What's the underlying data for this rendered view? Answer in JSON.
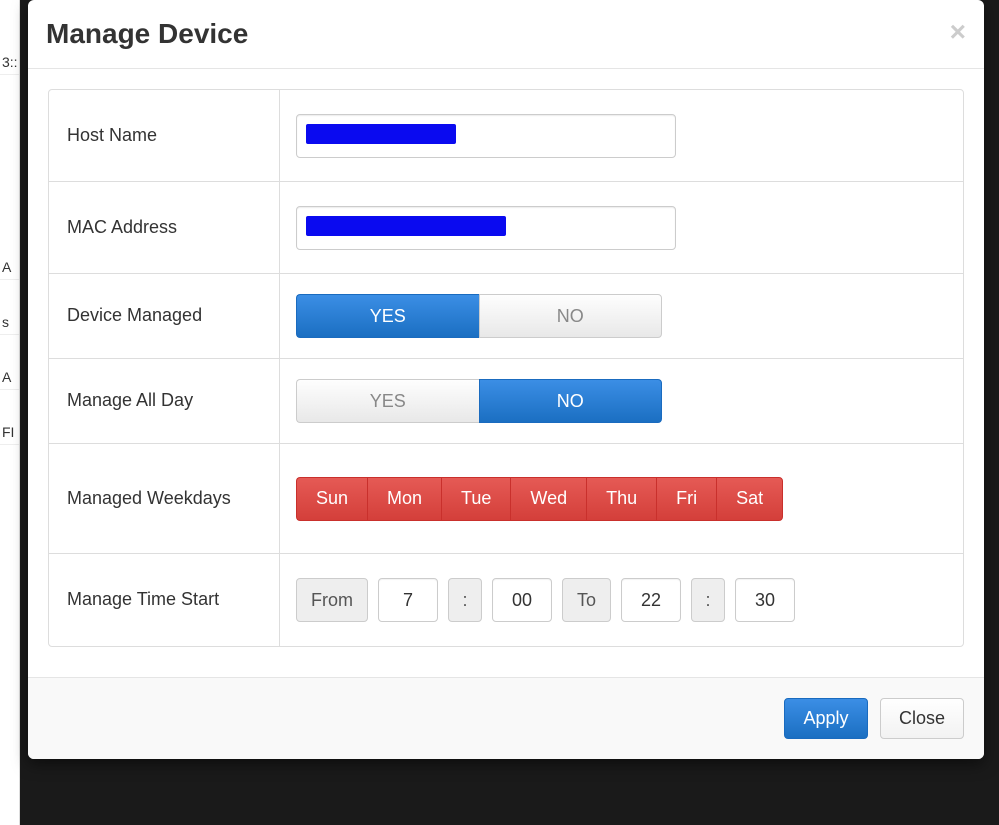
{
  "background_fragments": [
    "3::",
    "A",
    "s",
    "A",
    "FI"
  ],
  "modal": {
    "title": "Manage Device",
    "rows": {
      "host_name": {
        "label": "Host Name",
        "value": ""
      },
      "mac_address": {
        "label": "MAC Address",
        "value": ""
      },
      "device_managed": {
        "label": "Device Managed",
        "yes": "YES",
        "no": "NO",
        "selected": "yes"
      },
      "manage_all_day": {
        "label": "Manage All Day",
        "yes": "YES",
        "no": "NO",
        "selected": "no"
      },
      "weekdays": {
        "label": "Managed Weekdays",
        "days": [
          "Sun",
          "Mon",
          "Tue",
          "Wed",
          "Thu",
          "Fri",
          "Sat"
        ]
      },
      "time_start": {
        "label": "Manage Time Start",
        "from_label": "From",
        "to_label": "To",
        "colon": ":",
        "from_hour": "7",
        "from_min": "00",
        "to_hour": "22",
        "to_min": "30"
      }
    },
    "footer": {
      "apply": "Apply",
      "close": "Close"
    }
  }
}
